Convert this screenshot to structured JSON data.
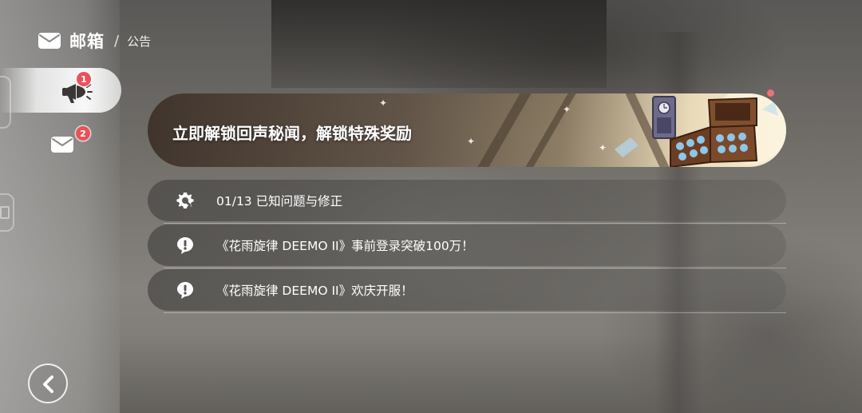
{
  "header": {
    "title": "邮箱",
    "separator": "/",
    "subtitle": "公告",
    "icon": "mail-icon"
  },
  "sidebar": {
    "tabs": [
      {
        "id": "announcements",
        "icon": "megaphone-icon",
        "badge": "1",
        "active": true
      },
      {
        "id": "mail",
        "icon": "mail-icon",
        "badge": "2",
        "active": false
      }
    ]
  },
  "banner": {
    "text": "立即解锁回声秘闻，解锁特殊奖励",
    "has_unread_dot": true
  },
  "notices": [
    {
      "icon": "gear-wrench-icon",
      "title": "01/13 已知问题与修正"
    },
    {
      "icon": "exclamation-bubble-icon",
      "title": "《花雨旋律 DEEMO II》事前登录突破100万！"
    },
    {
      "icon": "exclamation-bubble-icon",
      "title": "《花雨旋律 DEEMO II》欢庆开服！"
    }
  ],
  "footer": {
    "back_icon": "chevron-left-icon"
  },
  "colors": {
    "badge": "#e8525a",
    "banner_dot": "#ef6f7a",
    "text": "#ffffff"
  }
}
